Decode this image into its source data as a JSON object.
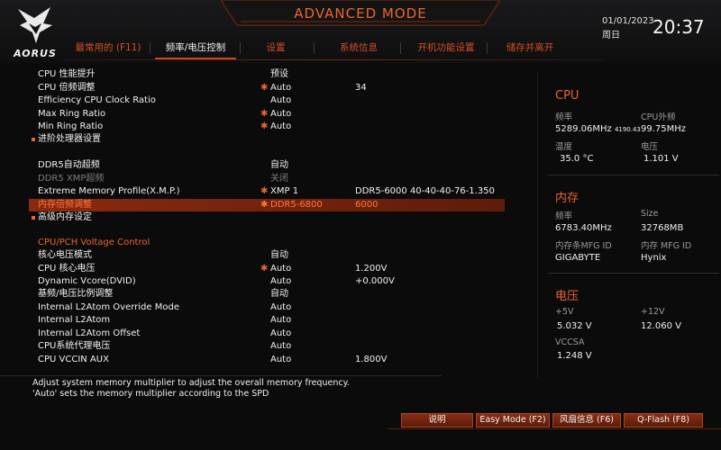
{
  "header": {
    "logo_text": "AORUS",
    "mode_title": "ADVANCED MODE",
    "date": "01/01/2023",
    "weekday": "周日",
    "time": "20:37",
    "accent_color": "#e8662e"
  },
  "tabs": [
    {
      "label": "最常用的 (F11)",
      "active": false
    },
    {
      "label": "频率/电压控制",
      "active": true
    },
    {
      "label": "设置",
      "active": false
    },
    {
      "label": "系统信息",
      "active": false
    },
    {
      "label": "开机功能设置",
      "active": false
    },
    {
      "label": "储存并离开",
      "active": false
    }
  ],
  "main": {
    "rows": [
      {
        "label": "CPU 性能提升",
        "value": "预设"
      },
      {
        "label": "CPU 倍频调整",
        "value": "Auto",
        "extra": "34",
        "starred": true
      },
      {
        "label": "Efficiency CPU Clock Ratio",
        "value": "Auto"
      },
      {
        "label": "Max Ring Ratio",
        "value": "Auto",
        "starred": true
      },
      {
        "label": "Min Ring Ratio",
        "value": "Auto",
        "starred": true
      },
      {
        "label": "进阶处理器设置",
        "submenu": true
      },
      {
        "label": "DDR5自动超频",
        "value": "自动"
      },
      {
        "label": "DDR5 XMP超频",
        "value": "关闭",
        "dim": true
      },
      {
        "label": "Extreme Memory Profile(X.M.P.)",
        "value": "XMP 1",
        "extra": "DDR5-6000 40-40-40-76-1.350",
        "starred": true
      },
      {
        "label": "内存倍频调整",
        "value": "DDR5-6800",
        "extra": "6000",
        "starred": true,
        "selected": true
      },
      {
        "label": "高级内存设定",
        "submenu": true
      },
      {
        "label": "核心电压模式",
        "value": "自动"
      },
      {
        "label": "CPU 核心电压",
        "value": "Auto",
        "extra": "1.200V",
        "starred": true
      },
      {
        "label": "Dynamic Vcore(DVID)",
        "value": "Auto",
        "extra": "+0.000V"
      },
      {
        "label": "基频/电压比例调整",
        "value": "自动"
      },
      {
        "label": "Internal L2Atom Override Mode",
        "value": "Auto"
      },
      {
        "label": "Internal L2Atom",
        "value": "Auto"
      },
      {
        "label": "Internal L2Atom Offset",
        "value": "Auto"
      },
      {
        "label": "CPU系统代理电压",
        "value": "Auto"
      },
      {
        "label": "CPU VCCIN AUX",
        "value": "Auto",
        "extra": "1.800V"
      }
    ],
    "section_title": "CPU/PCH Voltage Control"
  },
  "panel": {
    "cpu": {
      "title": "CPU",
      "freq_label": "频率",
      "freq_value": "5289.06MHz",
      "freq_sub": "4190.43",
      "ext_label": "CPU外频",
      "ext_value": "99.75MHz",
      "temp_label": "温度",
      "temp_value": "35.0 °C",
      "volt_label": "电压",
      "volt_value": "1.101 V"
    },
    "memory": {
      "title": "内存",
      "freq_label": "频率",
      "freq_value": "6783.40MHz",
      "size_label": "Size",
      "size_value": "32768MB",
      "mfg_label": "内存条MFG ID",
      "mfg_value": "GIGABYTE",
      "chip_label": "内存 MFG ID",
      "chip_value": "Hynix"
    },
    "voltage": {
      "title": "电压",
      "v5_label": "+5V",
      "v5_value": "5.032 V",
      "v12_label": "+12V",
      "v12_value": "12.060 V",
      "vccsa_label": "VCCSA",
      "vccsa_value": "1.248 V"
    }
  },
  "help": {
    "line1": "Adjust system memory multiplier to adjust the overall memory frequency.",
    "line2": "'Auto' sets the memory multiplier according to the SPD"
  },
  "footer": {
    "help_label": "说明",
    "easy_mode_label": "Easy Mode (F2)",
    "fan_label": "风扇信息 (F6)",
    "qflash_label": "Q-Flash (F8)"
  }
}
